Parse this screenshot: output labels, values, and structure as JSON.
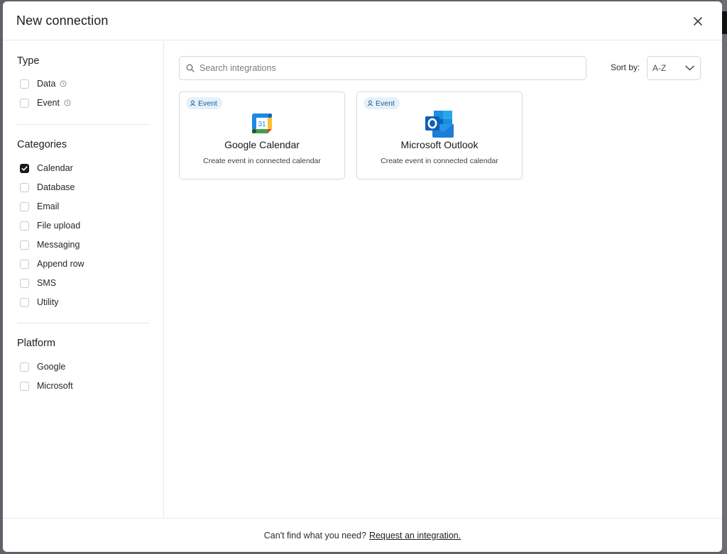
{
  "modal": {
    "title": "New connection"
  },
  "filters": {
    "type": {
      "title": "Type",
      "items": [
        {
          "label": "Data",
          "checked": false
        },
        {
          "label": "Event",
          "checked": false
        }
      ]
    },
    "categories": {
      "title": "Categories",
      "items": [
        {
          "label": "Calendar",
          "checked": true
        },
        {
          "label": "Database",
          "checked": false
        },
        {
          "label": "Email",
          "checked": false
        },
        {
          "label": "File upload",
          "checked": false
        },
        {
          "label": "Messaging",
          "checked": false
        },
        {
          "label": "Append row",
          "checked": false
        },
        {
          "label": "SMS",
          "checked": false
        },
        {
          "label": "Utility",
          "checked": false
        }
      ]
    },
    "platform": {
      "title": "Platform",
      "items": [
        {
          "label": "Google",
          "checked": false
        },
        {
          "label": "Microsoft",
          "checked": false
        }
      ]
    }
  },
  "search": {
    "placeholder": "Search integrations",
    "value": ""
  },
  "sort": {
    "label": "Sort by:",
    "value": "A-Z"
  },
  "integrations": [
    {
      "badge": "Event",
      "name": "Google Calendar",
      "description": "Create event in connected calendar",
      "icon": "google-calendar-logo"
    },
    {
      "badge": "Event",
      "name": "Microsoft Outlook",
      "description": "Create event in connected calendar",
      "icon": "microsoft-outlook-logo"
    }
  ],
  "footer": {
    "text": "Can't find what you need?",
    "link": "Request an integration."
  },
  "colors": {
    "badge_bg": "#e4f1fb",
    "badge_text": "#1f5d8c",
    "checkbox_checked": "#1a1a1a"
  }
}
